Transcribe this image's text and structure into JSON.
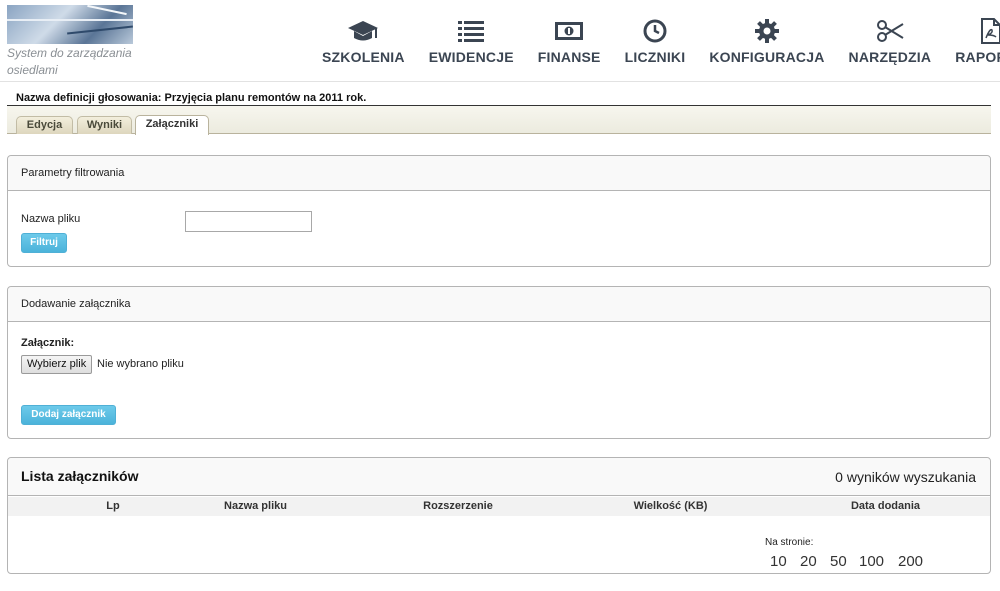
{
  "header": {
    "tagline": "System do zarządzania osiedlami",
    "nav": [
      {
        "label": "SZKOLENIA",
        "icon": "graduation-cap-icon"
      },
      {
        "label": "EWIDENCJE",
        "icon": "list-icon"
      },
      {
        "label": "FINANSE",
        "icon": "banknote-icon"
      },
      {
        "label": "LICZNIKI",
        "icon": "clock-icon"
      },
      {
        "label": "KONFIGURACJA",
        "icon": "gear-icon"
      },
      {
        "label": "NARZĘDZIA",
        "icon": "scissors-icon"
      },
      {
        "label": "RAPORTY",
        "icon": "pdf-file-icon"
      }
    ]
  },
  "definition": {
    "title": "Nazwa definicji głosowania: Przyjęcia planu remontów na 2011 rok."
  },
  "tabs": [
    {
      "label": "Edycja",
      "active": false
    },
    {
      "label": "Wyniki",
      "active": false
    },
    {
      "label": "Załączniki",
      "active": true
    }
  ],
  "filter": {
    "heading": "Parametry filtrowania",
    "field_label": "Nazwa pliku",
    "field_value": "",
    "button": "Filtruj"
  },
  "upload": {
    "heading": "Dodawanie załącznika",
    "field_label": "Załącznik:",
    "choose_button": "Wybierz plik",
    "no_file": "Nie wybrano pliku",
    "submit": "Dodaj załącznik"
  },
  "list": {
    "title": "Lista załączników",
    "results": "0 wyników wyszukania",
    "columns": [
      "Lp",
      "Nazwa pliku",
      "Rozszerzenie",
      "Wielkość (KB)",
      "Data dodania"
    ],
    "per_page_label": "Na stronie:",
    "per_page_options": [
      "10",
      "20",
      "50",
      "100",
      "200"
    ]
  },
  "colors": {
    "accent": "#5bc0de",
    "nav_text": "#3b4552"
  }
}
